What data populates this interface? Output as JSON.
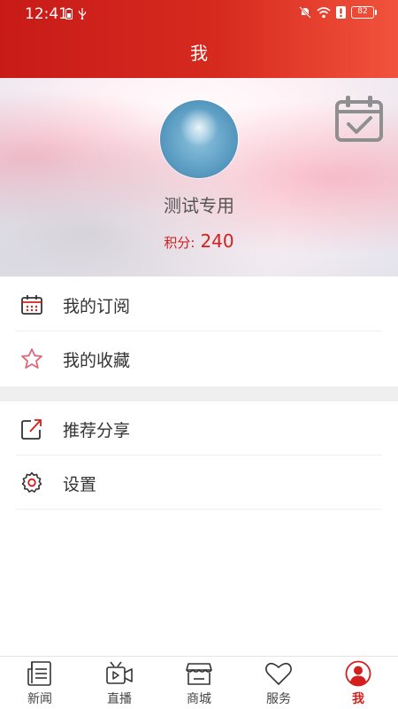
{
  "status_bar": {
    "time": "12:41",
    "battery": "82"
  },
  "header": {
    "title": "我"
  },
  "profile": {
    "username": "测试专用",
    "points_label": "积分:",
    "points_value": "240",
    "avatar_icon": "avatar-image",
    "checkin_icon": "calendar-check-icon"
  },
  "menu_group_1": [
    {
      "label": "我的订阅",
      "icon": "calendar-icon"
    },
    {
      "label": "我的收藏",
      "icon": "star-icon"
    }
  ],
  "menu_group_2": [
    {
      "label": "推荐分享",
      "icon": "share-icon"
    },
    {
      "label": "设置",
      "icon": "gear-icon"
    }
  ],
  "tabbar": [
    {
      "label": "新闻",
      "icon": "news-icon",
      "active": false
    },
    {
      "label": "直播",
      "icon": "live-video-icon",
      "active": false
    },
    {
      "label": "商城",
      "icon": "store-icon",
      "active": false
    },
    {
      "label": "服务",
      "icon": "heart-icon",
      "active": false
    },
    {
      "label": "我",
      "icon": "user-icon",
      "active": true
    }
  ],
  "colors": {
    "brand_red": "#d41f1f",
    "header_start": "#c81b18",
    "header_end": "#f2533c"
  }
}
